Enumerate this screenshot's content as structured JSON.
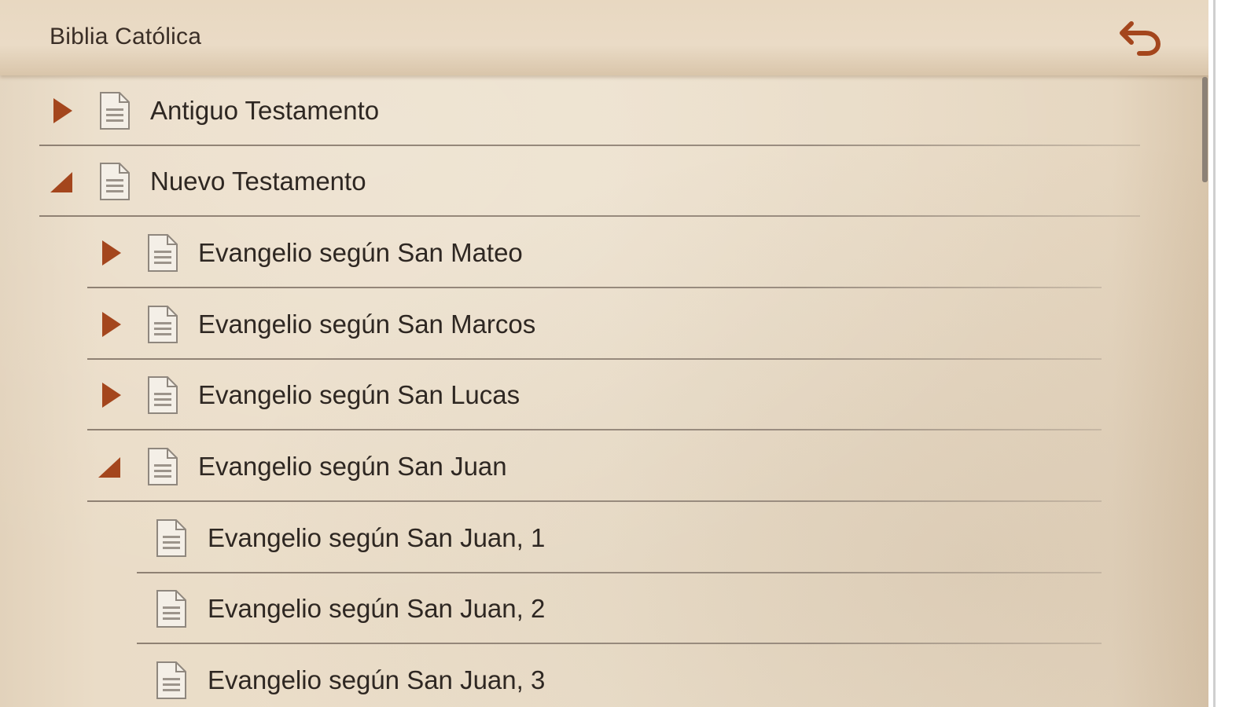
{
  "header": {
    "title": "Biblia Católica",
    "back_icon": "undo-arrow-icon"
  },
  "colors": {
    "accent": "#a4461d",
    "text": "#2e2722",
    "paper": "#eadcc7",
    "divider": "#8f8173"
  },
  "tree": [
    {
      "label": "Antiguo Testamento",
      "level": 0,
      "expanded": false,
      "toggle_icon": "triangle-right-icon",
      "doc_icon": "document-icon"
    },
    {
      "label": "Nuevo Testamento",
      "level": 0,
      "expanded": true,
      "toggle_icon": "triangle-up-icon",
      "doc_icon": "document-icon"
    },
    {
      "label": "Evangelio según San Mateo",
      "level": 1,
      "expanded": false,
      "toggle_icon": "triangle-right-icon",
      "doc_icon": "document-icon"
    },
    {
      "label": "Evangelio según San Marcos",
      "level": 1,
      "expanded": false,
      "toggle_icon": "triangle-right-icon",
      "doc_icon": "document-icon"
    },
    {
      "label": "Evangelio según San Lucas",
      "level": 1,
      "expanded": false,
      "toggle_icon": "triangle-right-icon",
      "doc_icon": "document-icon"
    },
    {
      "label": "Evangelio según San Juan",
      "level": 1,
      "expanded": true,
      "toggle_icon": "triangle-up-icon",
      "doc_icon": "document-icon"
    },
    {
      "label": "Evangelio según San Juan, 1",
      "level": 2,
      "doc_icon": "document-icon"
    },
    {
      "label": "Evangelio según San Juan, 2",
      "level": 2,
      "doc_icon": "document-icon"
    },
    {
      "label": "Evangelio según San Juan, 3",
      "level": 2,
      "doc_icon": "document-icon"
    }
  ]
}
